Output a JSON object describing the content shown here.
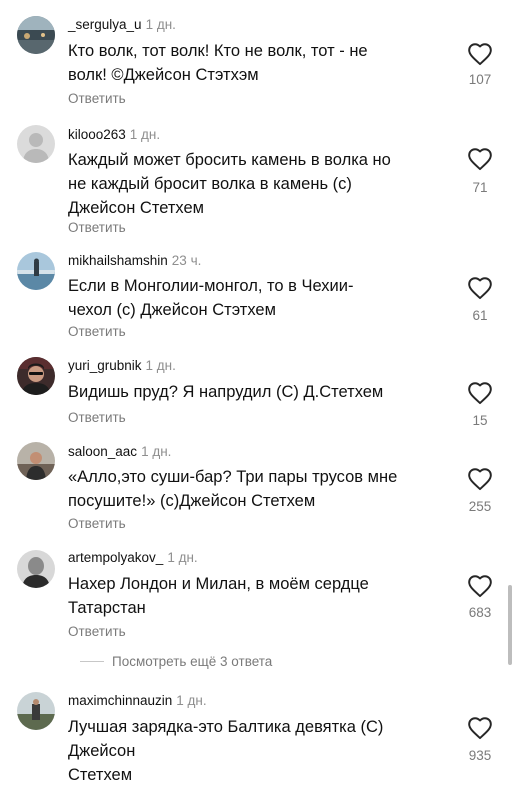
{
  "reply_label": "Ответить",
  "view_more_replies": "Посмотреть ещё 3 ответа",
  "icons": {
    "like": "heart-outline-icon"
  },
  "colors": {
    "username": "#111111",
    "meta_gray": "#8e8e8e",
    "heart_stroke": "#262626"
  },
  "comments": [
    {
      "username": "_sergulya_u",
      "time": "1 дн.",
      "lines": [
        "Кто волк, тот волк! Кто не волк, тот - не",
        "волк! ©Джейсон Стэтхэм"
      ],
      "likes": "107"
    },
    {
      "username": "kilooo263",
      "time": "1 дн.",
      "lines": [
        "Каждый может бросить камень в волка но",
        "не каждый бросит волка в камень (с)",
        "Джейсон Стетхем"
      ],
      "likes": "71"
    },
    {
      "username": "mikhailshamshin",
      "time": "23 ч.",
      "lines": [
        "Если в Монголии-монгол, то в Чехии-",
        "чехол (с) Джейсон Стэтхем"
      ],
      "likes": "61"
    },
    {
      "username": "yuri_grubnik",
      "time": "1 дн.",
      "lines": [
        "Видишь пруд? Я напрудил (С) Д.Стетхем"
      ],
      "likes": "15"
    },
    {
      "username": "saloon_aac",
      "time": "1 дн.",
      "lines": [
        "«Алло,это суши-бар? Три пары трусов мне",
        "посушите!» (с)Джейсон Стетхем"
      ],
      "likes": "255"
    },
    {
      "username": "artempolyakov_",
      "time": "1 дн.",
      "lines": [
        "Нахер Лондон и Милан, в моём сердце",
        "Татарстан"
      ],
      "likes": "683"
    },
    {
      "username": "maximchinnauzin",
      "time": "1 дн.",
      "lines": [
        "Лучшая зарядка-это Балтика девятка (С)",
        "Джейсон",
        "Стетхем"
      ],
      "likes": "935"
    }
  ]
}
